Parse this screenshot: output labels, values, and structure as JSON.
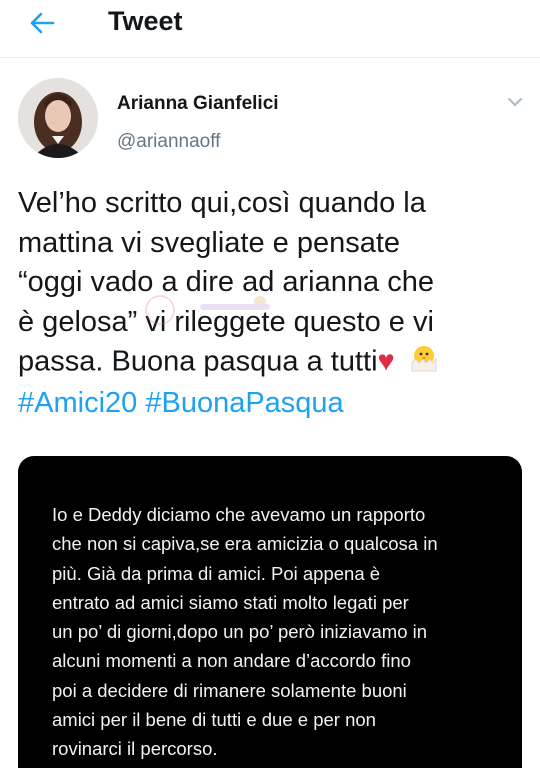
{
  "header": {
    "title": "Tweet",
    "back_icon": "arrow-left-icon",
    "accent_color": "#1da1f2"
  },
  "author": {
    "name": "Arianna Gianfelici",
    "handle": "@ariannaoff",
    "avatar_icon": "user-avatar",
    "menu_icon": "chevron-down-icon"
  },
  "tweet": {
    "lines": [
      "Vel’ho scritto qui,così quando la",
      "mattina vi svegliate e pensate",
      "“oggi vado a dire ad arianna che",
      "è gelosa” vi rileggete questo e vi",
      "passa. Buona pasqua a tutti"
    ],
    "emoji_heart": "♥",
    "emoji_chick_icon": "hatching-chick-icon",
    "hashtags": [
      "#Amici20",
      "#BuonaPasqua"
    ],
    "hashtag_color": "#1da1f2"
  },
  "media": {
    "background": "#000000",
    "lines": [
      "Io e Deddy diciamo che avevamo un rapporto",
      "che non si capiva,se era amicizia o qualcosa in",
      "più. Già da prima di amici. Poi appena è",
      "entrato ad amici siamo stati molto legati per",
      "un po’ di giorni,dopo un po’ però iniziavamo in",
      "alcuni momenti a non andare d’accordo fino",
      "poi a decidere di rimanere solamente buoni",
      "amici per il bene di tutti e due e per non",
      "rovinarci il percorso."
    ]
  }
}
